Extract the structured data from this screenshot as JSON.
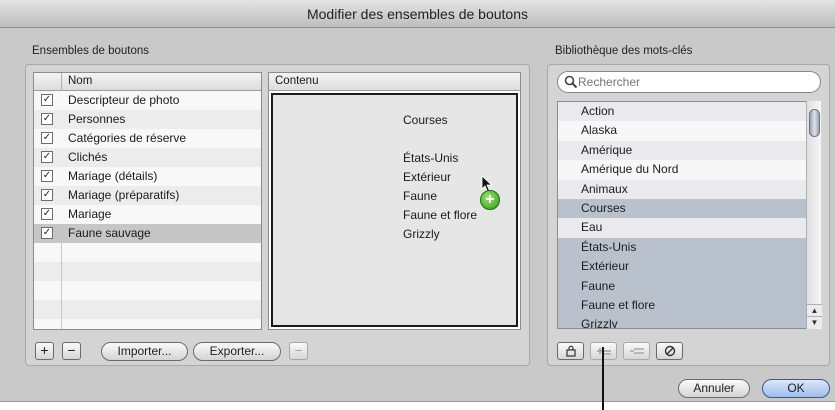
{
  "window": {
    "title": "Modifier des ensembles de boutons"
  },
  "sets": {
    "label": "Ensembles de boutons",
    "column_name": "Nom",
    "items": [
      {
        "label": "Descripteur de photo",
        "checked": true
      },
      {
        "label": "Personnes",
        "checked": true
      },
      {
        "label": "Catégories de réserve",
        "checked": true
      },
      {
        "label": "Clichés",
        "checked": true
      },
      {
        "label": "Mariage (détails)",
        "checked": true
      },
      {
        "label": "Mariage (préparatifs)",
        "checked": true
      },
      {
        "label": "Mariage",
        "checked": true
      },
      {
        "label": "Faune sauvage",
        "checked": true,
        "selected": true
      }
    ],
    "add_label": "+",
    "remove_label": "−",
    "import_label": "Importer...",
    "export_label": "Exporter..."
  },
  "contents": {
    "header": "Contenu",
    "items": [
      "Courses",
      "",
      "États-Unis",
      "Extérieur",
      "Faune",
      "Faune et flore",
      "Grizzly"
    ],
    "remove_label": "−"
  },
  "library": {
    "label": "Bibliothèque des mots-clés",
    "search_placeholder": "Rechercher",
    "keywords": [
      {
        "label": "Action",
        "highlighted": false
      },
      {
        "label": "Alaska",
        "highlighted": false
      },
      {
        "label": "Amérique",
        "highlighted": false
      },
      {
        "label": "Amérique du Nord",
        "highlighted": false
      },
      {
        "label": "Animaux",
        "highlighted": false
      },
      {
        "label": "Courses",
        "highlighted": true
      },
      {
        "label": "Eau",
        "highlighted": false
      },
      {
        "label": "États-Unis",
        "highlighted": true
      },
      {
        "label": "Extérieur",
        "highlighted": true
      },
      {
        "label": "Faune",
        "highlighted": true
      },
      {
        "label": "Faune et flore",
        "highlighted": true
      },
      {
        "label": "Grizzly",
        "highlighted": true
      }
    ]
  },
  "footer": {
    "cancel_label": "Annuler",
    "ok_label": "OK"
  },
  "icons": {
    "search": "magnifier-icon",
    "lock": "lock-icon",
    "add_keyword": "add-keyword-icon",
    "add_keyword_alt": "add-keyword-alt-icon",
    "stop": "stop-icon",
    "drag_plus": "green-plus-badge-icon",
    "cursor": "arrow-cursor-icon"
  },
  "colors": {
    "highlight_row": "#b9c1cd",
    "drag_badge": "#2c9a18"
  }
}
